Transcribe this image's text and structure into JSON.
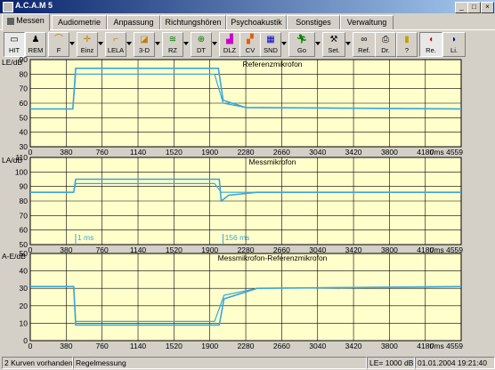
{
  "window": {
    "title": "A.C.A.M 5",
    "min": "_",
    "max": "□",
    "close": "×"
  },
  "tabs": [
    "Messen",
    "Audiometrie",
    "Anpassung",
    "Richtungshören",
    "Psychoakustik",
    "Sonstiges",
    "Verwaltung"
  ],
  "toolbar": [
    "HIT",
    "REM",
    "F",
    "Einz",
    "LELA",
    "3-D",
    "RZ",
    "DT",
    "DLZ",
    "CV",
    "SND",
    "Go",
    "Set.",
    "Ref.",
    "Dr.",
    "?",
    "Re.",
    "Li."
  ],
  "chart_data": [
    {
      "type": "line",
      "title": "Referenzmikrofon",
      "ylabel": "LE/dB",
      "xlabel": "t/ms",
      "ylim": [
        30,
        90
      ],
      "yticks": [
        "90",
        "80",
        "70",
        "60",
        "50",
        "40",
        "30"
      ],
      "xlim": [
        0,
        4559
      ],
      "xticks": [
        "0",
        "380",
        "760",
        "1140",
        "1520",
        "1900",
        "2280",
        "2660",
        "3040",
        "3420",
        "3800",
        "4180",
        "4559"
      ],
      "series": [
        {
          "values": [
            [
              0,
              56
            ],
            [
              450,
              56
            ],
            [
              480,
              84
            ],
            [
              1950,
              84
            ],
            [
              1990,
              84
            ],
            [
              2040,
              62
            ],
            [
              2280,
              57
            ],
            [
              4559,
              56
            ]
          ]
        },
        {
          "values": [
            [
              0,
              56
            ],
            [
              450,
              56
            ],
            [
              480,
              80
            ],
            [
              1950,
              80
            ],
            [
              2040,
              60
            ],
            [
              2280,
              57
            ],
            [
              4559,
              56
            ]
          ]
        }
      ]
    },
    {
      "type": "line",
      "title": "Messmikrofon",
      "ylabel": "LA/dB",
      "xlabel": "t/ms",
      "ylim": [
        50,
        110
      ],
      "yticks": [
        "110",
        "100",
        "90",
        "80",
        "70",
        "60",
        "50"
      ],
      "xlim": [
        0,
        4559
      ],
      "xticks": [
        "0",
        "380",
        "760",
        "1140",
        "1520",
        "1900",
        "2280",
        "2660",
        "3040",
        "3420",
        "3800",
        "4180",
        "4559"
      ],
      "annotations": [
        "1 ms",
        "156 ms"
      ],
      "series": [
        {
          "values": [
            [
              0,
              86
            ],
            [
              460,
              86
            ],
            [
              480,
              95
            ],
            [
              1950,
              95
            ],
            [
              2000,
              95
            ],
            [
              2020,
              80
            ],
            [
              2100,
              84
            ],
            [
              2400,
              86
            ],
            [
              4559,
              86
            ]
          ]
        },
        {
          "values": [
            [
              0,
              86
            ],
            [
              460,
              86
            ],
            [
              480,
              92
            ],
            [
              1950,
              92
            ],
            [
              2020,
              86
            ],
            [
              4559,
              86
            ]
          ]
        }
      ]
    },
    {
      "type": "line",
      "title": "Messmikrofon-Referenzmikrofon",
      "ylabel": "A-E/dB",
      "xlabel": "t/ms",
      "ylim": [
        0,
        50
      ],
      "yticks": [
        "50",
        "40",
        "30",
        "20",
        "10",
        "0"
      ],
      "xlim": [
        0,
        4559
      ],
      "xticks": [
        "0",
        "380",
        "760",
        "1140",
        "1520",
        "1900",
        "2280",
        "2660",
        "3040",
        "3420",
        "3800",
        "4180",
        "4559"
      ],
      "series": [
        {
          "values": [
            [
              0,
              31
            ],
            [
              460,
              31
            ],
            [
              480,
              9
            ],
            [
              1950,
              9
            ],
            [
              2000,
              9
            ],
            [
              2050,
              24
            ],
            [
              2400,
              30
            ],
            [
              4559,
              31
            ]
          ]
        },
        {
          "values": [
            [
              0,
              31
            ],
            [
              460,
              31
            ],
            [
              480,
              11
            ],
            [
              1950,
              11
            ],
            [
              2050,
              26
            ],
            [
              2400,
              30
            ],
            [
              4559,
              31
            ]
          ]
        }
      ]
    }
  ],
  "status": {
    "curves": "2 Kurven vorhanden",
    "mode": "Regelmessung",
    "le": "LE= 1000 dB",
    "datetime": "01.01.2004 19:21:40"
  },
  "colors": {
    "plot_bg": "#ffffcc",
    "trace": "#3aa6d8",
    "titlebar": "#0a246a"
  }
}
